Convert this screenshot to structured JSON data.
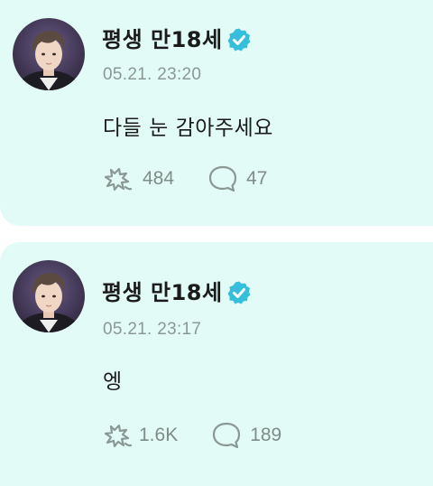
{
  "posts": [
    {
      "author": "평생 만18세",
      "verified_icon": "verified-badge-icon",
      "timestamp": "05.21. 23:20",
      "message": "다들 눈 감아주세요",
      "likes": "484",
      "comments": "47"
    },
    {
      "author": "평생 만18세",
      "verified_icon": "verified-badge-icon",
      "timestamp": "05.21. 23:17",
      "message": "엥",
      "likes": "1.6K",
      "comments": "189"
    }
  ],
  "colors": {
    "card_background": "#e3fbf7",
    "verified_badge": "#34c0dd",
    "muted_text": "#8a9894"
  }
}
